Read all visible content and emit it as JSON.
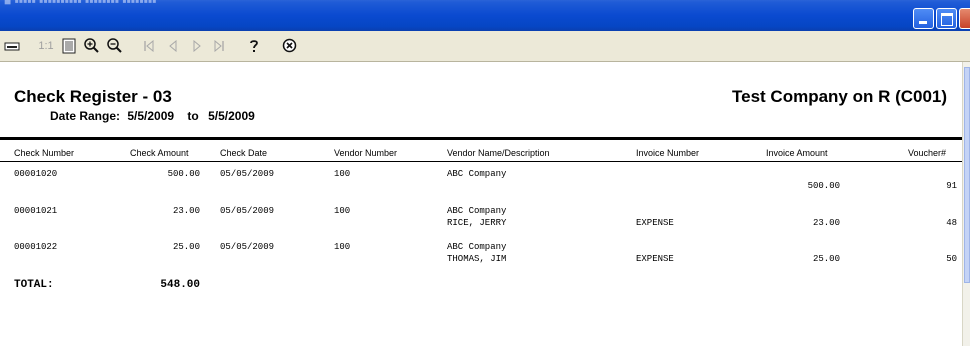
{
  "window": {
    "title": "■ ▪▪▪▪▪ ▪▪▪▪▪▪▪▪▪▪ ▪▪▪▪▪▪▪▪ ▪▪▪▪▪▪▪▪"
  },
  "toolbar": {
    "ratio_label": "1:1",
    "icons": [
      "page-setup-icon",
      "one-to-one-icon",
      "fit-page-icon",
      "zoom-in-icon",
      "zoom-out-icon",
      "first-page-icon",
      "previous-page-icon",
      "next-page-icon",
      "last-page-icon",
      "help-icon",
      "close-report-icon"
    ]
  },
  "report": {
    "title": "Check Register - 03",
    "company": "Test Company on R (C001)",
    "date_range_label": "Date Range:",
    "date_from": "5/5/2009",
    "date_to_word": "to",
    "date_to": "5/5/2009",
    "columns": [
      "Check Number",
      "Check Amount",
      "Check Date",
      "Vendor Number",
      "Vendor Name/Description",
      "Invoice Number",
      "Invoice Amount",
      "Voucher#"
    ],
    "rows": [
      {
        "check_number": "00001020",
        "check_amount": "500.00",
        "check_date": "05/05/2009",
        "vendor_number": "100",
        "vendor_name": "ABC Company",
        "description": "",
        "invoice_number": "",
        "invoice_amount": "500.00",
        "voucher": "91"
      },
      {
        "check_number": "00001021",
        "check_amount": "23.00",
        "check_date": "05/05/2009",
        "vendor_number": "100",
        "vendor_name": "ABC Company",
        "description": "RICE, JERRY",
        "invoice_number": "EXPENSE",
        "invoice_amount": "23.00",
        "voucher": "48"
      },
      {
        "check_number": "00001022",
        "check_amount": "25.00",
        "check_date": "05/05/2009",
        "vendor_number": "100",
        "vendor_name": "ABC Company",
        "description": "THOMAS, JIM",
        "invoice_number": "EXPENSE",
        "invoice_amount": "25.00",
        "voucher": "50"
      }
    ],
    "total_label": "TOTAL:",
    "total_value": "548.00"
  }
}
